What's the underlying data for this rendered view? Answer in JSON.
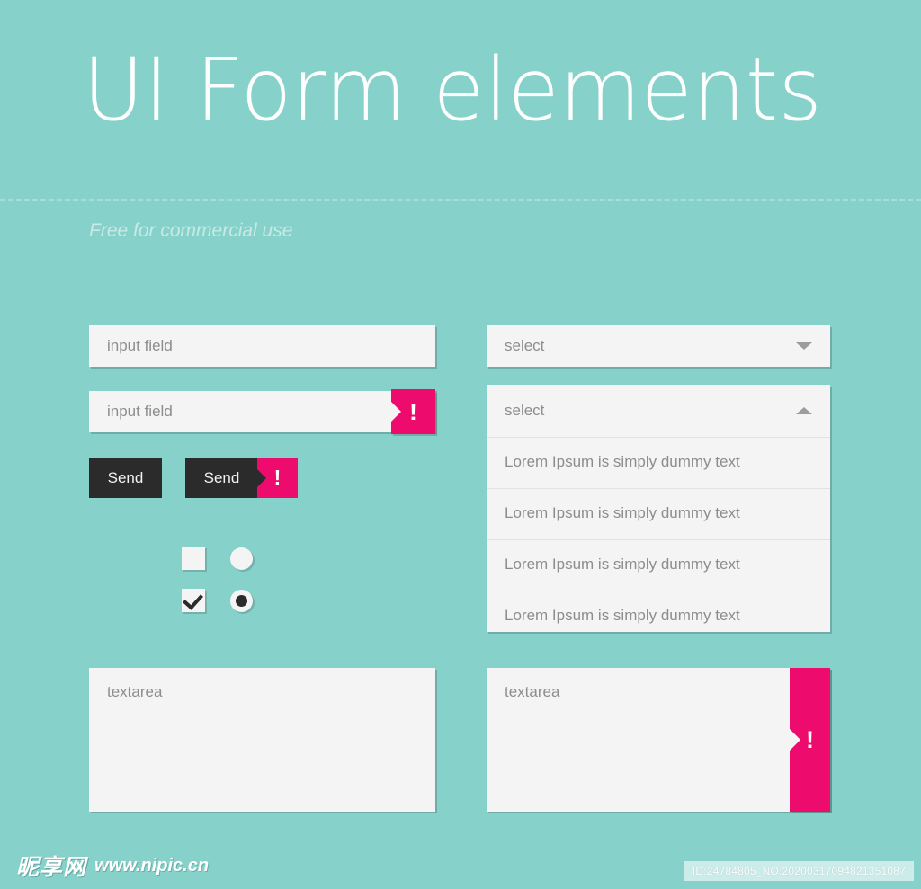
{
  "header": {
    "title": "UI Form elements",
    "subtitle": "Free for commercial use"
  },
  "colors": {
    "background": "#86d2cb",
    "field": "#f4f4f4",
    "error": "#ee0b6e",
    "button": "#2b2b2b",
    "placeholder": "#8d8d8d",
    "divider": "#a8ded8"
  },
  "form": {
    "input_normal": {
      "placeholder": "input field",
      "value": ""
    },
    "input_error": {
      "placeholder": "input field",
      "value": "",
      "error_mark": "!"
    },
    "button_normal": {
      "label": "Send"
    },
    "button_error": {
      "label": "Send",
      "error_mark": "!"
    },
    "select_closed": {
      "value": "select",
      "caret": "chevron-down-icon"
    },
    "select_open": {
      "value": "select",
      "caret": "chevron-up-icon",
      "options": [
        "Lorem Ipsum is simply dummy text",
        "Lorem Ipsum is simply dummy text",
        "Lorem Ipsum is simply dummy text",
        "Lorem Ipsum is simply dummy text"
      ]
    },
    "textarea_normal": {
      "placeholder": "textarea",
      "value": ""
    },
    "textarea_error": {
      "placeholder": "textarea",
      "value": "",
      "error_mark": "!"
    },
    "checkbox_unchecked": {
      "checked": false
    },
    "checkbox_checked": {
      "checked": true
    },
    "radio_unchecked": {
      "checked": false
    },
    "radio_checked": {
      "checked": true
    }
  },
  "footer": {
    "watermark_cn": "昵享网",
    "watermark_url": "www.nipic.cn",
    "id_badge": "ID:24784805_NO:20200317094821351087"
  }
}
